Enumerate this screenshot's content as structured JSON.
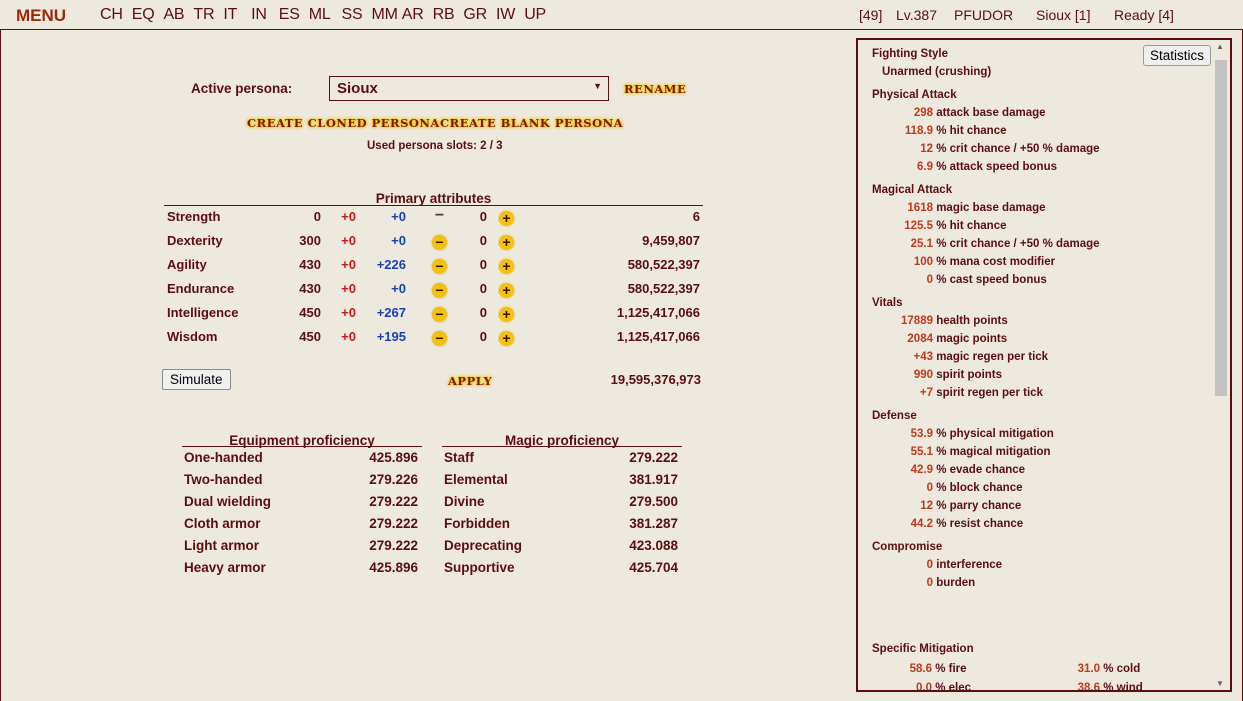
{
  "topbar": {
    "menu": "MENU",
    "nav": [
      "CH",
      "EQ",
      "AB",
      "TR",
      "IT",
      "IN",
      "ES",
      "ML",
      "SS",
      "MM",
      "AR",
      "RB",
      "GR",
      "IW",
      "UP"
    ],
    "status": {
      "count": "[49]",
      "level": "Lv.387",
      "user": "PFUDOR",
      "persona": "Sioux [1]",
      "ready": "Ready [4]"
    }
  },
  "persona": {
    "label": "Active persona:",
    "selected": "Sioux",
    "rename": "RENAME",
    "create_cloned": "CREATE CLONED PERSONA",
    "create_blank": "CREATE BLANK PERSONA",
    "slots": "Used persona slots: 2 / 3"
  },
  "primary": {
    "title": "Primary attributes",
    "rows": [
      {
        "name": "Strength",
        "base": "0",
        "bonus1": "+0",
        "bonus2": "+0",
        "alloc": "0",
        "cost": "6"
      },
      {
        "name": "Dexterity",
        "base": "300",
        "bonus1": "+0",
        "bonus2": "+0",
        "alloc": "0",
        "cost": "9,459,807"
      },
      {
        "name": "Agility",
        "base": "430",
        "bonus1": "+0",
        "bonus2": "+226",
        "alloc": "0",
        "cost": "580,522,397"
      },
      {
        "name": "Endurance",
        "base": "430",
        "bonus1": "+0",
        "bonus2": "+0",
        "alloc": "0",
        "cost": "580,522,397"
      },
      {
        "name": "Intelligence",
        "base": "450",
        "bonus1": "+0",
        "bonus2": "+267",
        "alloc": "0",
        "cost": "1,125,417,066"
      },
      {
        "name": "Wisdom",
        "base": "450",
        "bonus1": "+0",
        "bonus2": "+195",
        "alloc": "0",
        "cost": "1,125,417,066"
      }
    ],
    "simulate": "Simulate",
    "apply": "APPLY",
    "total": "19,595,376,973"
  },
  "equipment": {
    "title": "Equipment proficiency",
    "rows": [
      {
        "name": "One-handed",
        "value": "425.896"
      },
      {
        "name": "Two-handed",
        "value": "279.226"
      },
      {
        "name": "Dual wielding",
        "value": "279.222"
      },
      {
        "name": "Cloth armor",
        "value": "279.222"
      },
      {
        "name": "Light armor",
        "value": "279.222"
      },
      {
        "name": "Heavy armor",
        "value": "425.896"
      }
    ]
  },
  "magic": {
    "title": "Magic proficiency",
    "rows": [
      {
        "name": "Staff",
        "value": "279.222"
      },
      {
        "name": "Elemental",
        "value": "381.917"
      },
      {
        "name": "Divine",
        "value": "279.500"
      },
      {
        "name": "Forbidden",
        "value": "381.287"
      },
      {
        "name": "Deprecating",
        "value": "423.088"
      },
      {
        "name": "Supportive",
        "value": "425.704"
      }
    ]
  },
  "stats": {
    "button": "Statistics",
    "fighting_style": {
      "title": "Fighting Style",
      "value": "Unarmed (crushing)"
    },
    "physical": {
      "title": "Physical Attack",
      "lines": [
        {
          "num": "298",
          "text": "attack base damage"
        },
        {
          "num": "118.9",
          "text": "% hit chance"
        },
        {
          "num": "12",
          "text": "% crit chance / +50 % damage"
        },
        {
          "num": "6.9",
          "text": "% attack speed bonus"
        }
      ]
    },
    "magical": {
      "title": "Magical Attack",
      "lines": [
        {
          "num": "1618",
          "text": "magic base damage"
        },
        {
          "num": "125.5",
          "text": "% hit chance"
        },
        {
          "num": "25.1",
          "text": "% crit chance / +50 % damage"
        },
        {
          "num": "100",
          "text": "% mana cost modifier"
        },
        {
          "num": "0",
          "text": "% cast speed bonus"
        }
      ]
    },
    "vitals": {
      "title": "Vitals",
      "lines": [
        {
          "num": "17889",
          "text": "health points"
        },
        {
          "num": "2084",
          "text": "magic points"
        },
        {
          "num": "+43",
          "text": "magic regen per tick"
        },
        {
          "num": "990",
          "text": "spirit points"
        },
        {
          "num": "+7",
          "text": "spirit regen per tick"
        }
      ]
    },
    "defense": {
      "title": "Defense",
      "lines": [
        {
          "num": "53.9",
          "text": "% physical mitigation"
        },
        {
          "num": "55.1",
          "text": "% magical mitigation"
        },
        {
          "num": "42.9",
          "text": "% evade chance"
        },
        {
          "num": "0",
          "text": "% block chance"
        },
        {
          "num": "12",
          "text": "% parry chance"
        },
        {
          "num": "44.2",
          "text": "% resist chance"
        }
      ]
    },
    "compromise": {
      "title": "Compromise",
      "lines": [
        {
          "num": "0",
          "text": "interference"
        },
        {
          "num": "0",
          "text": "burden"
        }
      ]
    },
    "specific": {
      "title": "Specific Mitigation",
      "left": [
        {
          "num": "58.6",
          "text": "% fire"
        },
        {
          "num": "0.0",
          "text": "% elec"
        }
      ],
      "right": [
        {
          "num": "31.0",
          "text": "% cold"
        },
        {
          "num": "38.6",
          "text": "% wind"
        }
      ]
    }
  }
}
